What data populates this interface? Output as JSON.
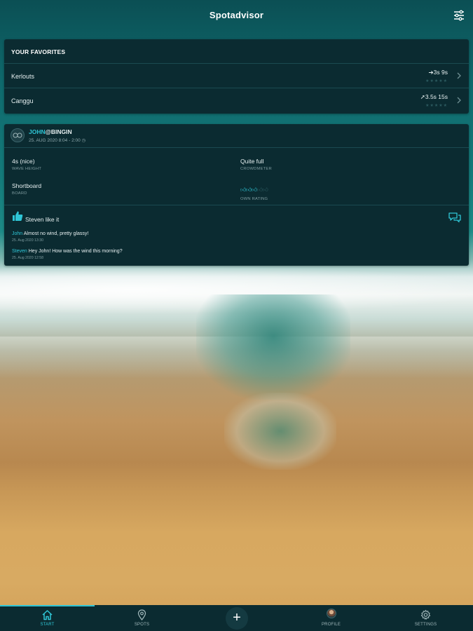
{
  "app": {
    "title": "Spotadvisor"
  },
  "icons": {
    "filter": "sliders-icon",
    "chevron": "chevron-right-icon",
    "like": "thumbs-up-icon",
    "comment": "chat-bubbles-icon",
    "home": "home-icon",
    "spots": "location-pin-icon",
    "add": "plus-icon",
    "profile": "avatar-icon",
    "settings": "gear-icon"
  },
  "colors": {
    "accent": "#2fc6d6",
    "card": "#0b2b31",
    "text": "#e6eff0"
  },
  "favorites": {
    "heading": "YOUR FAVORITES",
    "items": [
      {
        "name": "Kerlouts",
        "value": "➔3s 9s",
        "stars": "★★★★★"
      },
      {
        "name": "Canggu",
        "value": "➚3.5s 15s",
        "stars": "★★★★★"
      }
    ]
  },
  "post": {
    "user": "JOHN",
    "spot": "@BINGIN",
    "time": "25. AUG 2020 8:04 - 2:00 ◷",
    "stats": [
      {
        "value": "4s (nice)",
        "label": "WAVE HEIGHT"
      },
      {
        "value": "Quite full",
        "label": "CROWDMETER"
      },
      {
        "value": "Shortboard",
        "label": "BOARD"
      },
      {
        "label": "OWN RATING",
        "rating": 3,
        "rating_max": 5
      }
    ],
    "likes": "Steven like it",
    "comments": [
      {
        "author": "John",
        "text": " Almost no wind, pretty glassy!",
        "date": "25. Aug 2020 13:30"
      },
      {
        "author": "Steven",
        "text": " Hey John! How was the wind this morning?",
        "date": "25. Aug 2020 12:58"
      }
    ]
  },
  "nav": {
    "items": [
      {
        "label": "START",
        "active": true
      },
      {
        "label": "SPOTS",
        "active": false
      },
      {
        "label": "PROFILE",
        "active": false
      },
      {
        "label": "SETTINGS",
        "active": false
      }
    ],
    "add_label": "+"
  }
}
